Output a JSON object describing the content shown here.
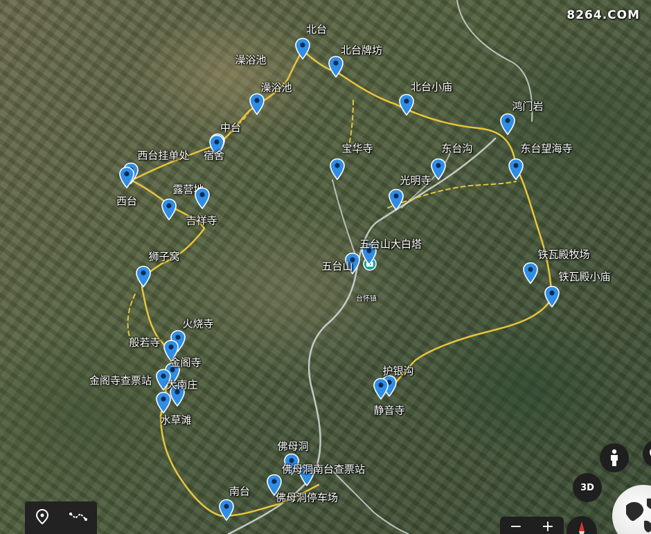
{
  "watermark": "8264.COM",
  "colors": {
    "pin": "#2f8de4",
    "trail": "#e8c53a",
    "road": "#d8d8d8"
  },
  "markers": [
    {
      "label": "北台"
    },
    {
      "label": "北台牌坊"
    },
    {
      "label": "澡浴池"
    },
    {
      "label": "北台小庙"
    },
    {
      "label": "鸿门岩"
    },
    {
      "label": "中台"
    },
    {
      "label": "宿舍"
    },
    {
      "label": "西台挂单处"
    },
    {
      "label": "宝华寺"
    },
    {
      "label": "东台沟"
    },
    {
      "label": "东台望海寺"
    },
    {
      "label": "西台"
    },
    {
      "label": "露营地"
    },
    {
      "label": "吉祥寺"
    },
    {
      "label": "光明寺"
    },
    {
      "label": "五台山大白塔"
    },
    {
      "label": "五台山"
    },
    {
      "label": "狮子窝"
    },
    {
      "label": "铁瓦殿牧场"
    },
    {
      "label": "铁瓦殿小庙"
    },
    {
      "label": "火烧寺"
    },
    {
      "label": "般若寺"
    },
    {
      "label": "金阁寺"
    },
    {
      "label": "金阁寺查票站"
    },
    {
      "label": "大南庄"
    },
    {
      "label": "护银沟"
    },
    {
      "label": "静音寺"
    },
    {
      "label": "水草滩"
    },
    {
      "label": "佛母洞"
    },
    {
      "label": "佛母洞南台查票站"
    },
    {
      "label": "南台"
    },
    {
      "label": "佛母洞停车场"
    }
  ],
  "area_labels": {
    "lake": "澡浴池",
    "town": "台怀镇"
  },
  "controls": {
    "btn3d": "3D",
    "zoom_out": "−",
    "zoom_in": "+",
    "icons": [
      "location-pin-icon",
      "route-icon",
      "street-view-person-icon",
      "compass-icon",
      "globe-icon"
    ]
  }
}
